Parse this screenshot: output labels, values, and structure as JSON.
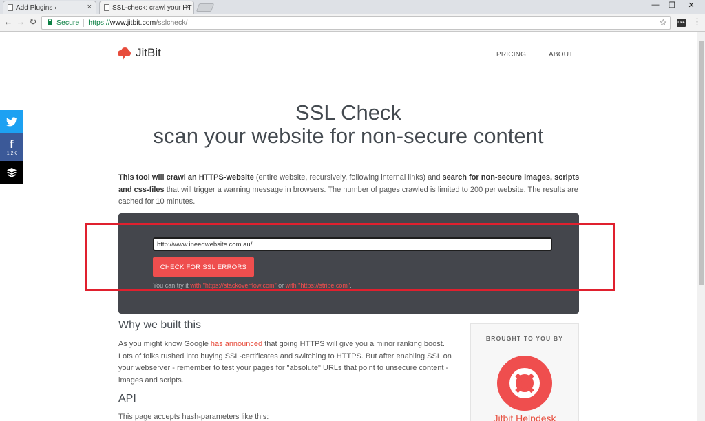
{
  "browser": {
    "tabs": [
      {
        "title": "Add Plugins ‹",
        "active": false
      },
      {
        "title": "SSL-check: crawl your HT",
        "active": true
      }
    ],
    "close_glyph": "×",
    "window_controls": [
      "—",
      "❐",
      "✕"
    ],
    "nav": {
      "back": "←",
      "forward": "→",
      "reload": "↻"
    },
    "secure_label": "Secure",
    "url_scheme": "https://",
    "url_host": "www.jitbit.com",
    "url_path": "/sslcheck/",
    "star": "☆",
    "extension_label": "OFF",
    "menu": "⋮"
  },
  "site": {
    "logo_text": "JitBit",
    "nav": [
      "PRICING",
      "ABOUT"
    ]
  },
  "share": {
    "twitter_glyph": "𝕥",
    "facebook_glyph": "f",
    "facebook_count": "1.2K"
  },
  "hero": {
    "line1": "SSL Check",
    "line2": "scan your website for non-secure content"
  },
  "intro": {
    "bold1": "This tool will crawl an HTTPS-website",
    "text1": " (entire website, recursively, following internal links) and ",
    "bold2": "search for non-secure images, scripts and css-files",
    "text2": " that will trigger a warning message in browsers. The number of pages crawled is limited to 200 per website. The results are cached for 10 minutes."
  },
  "checker": {
    "input_value": "http://www.ineedwebsite.com.au/",
    "button_label": "CHECK FOR SSL ERRORS",
    "try_prefix": "You can try it ",
    "try_link1": "with \"https://stackoverflow.com\"",
    "try_or": " or ",
    "try_link2": "with \"https://stripe.com\"",
    "try_suffix": "."
  },
  "why": {
    "heading": "Why we built this",
    "text_before": "As you might know Google ",
    "link": "has announced",
    "text_after": " that going HTTPS will give you a minor ranking boost. Lots of folks rushed into buying SSL-certificates and switching to HTTPS. But after enabling SSL on your webserver - remember to test your pages for \"absolute\" URLs that point to unsecure content - images and scripts."
  },
  "api": {
    "heading": "API",
    "text": "This page accepts hash-parameters like this:"
  },
  "sidebar": {
    "brought_by": "BROUGHT TO YOU BY",
    "product": "Jitbit Helpdesk"
  },
  "colors": {
    "accent": "#ef4e4e",
    "panel": "#44464c",
    "highlight": "#e0202e",
    "twitter": "#1da1f2",
    "facebook": "#3b5998"
  }
}
